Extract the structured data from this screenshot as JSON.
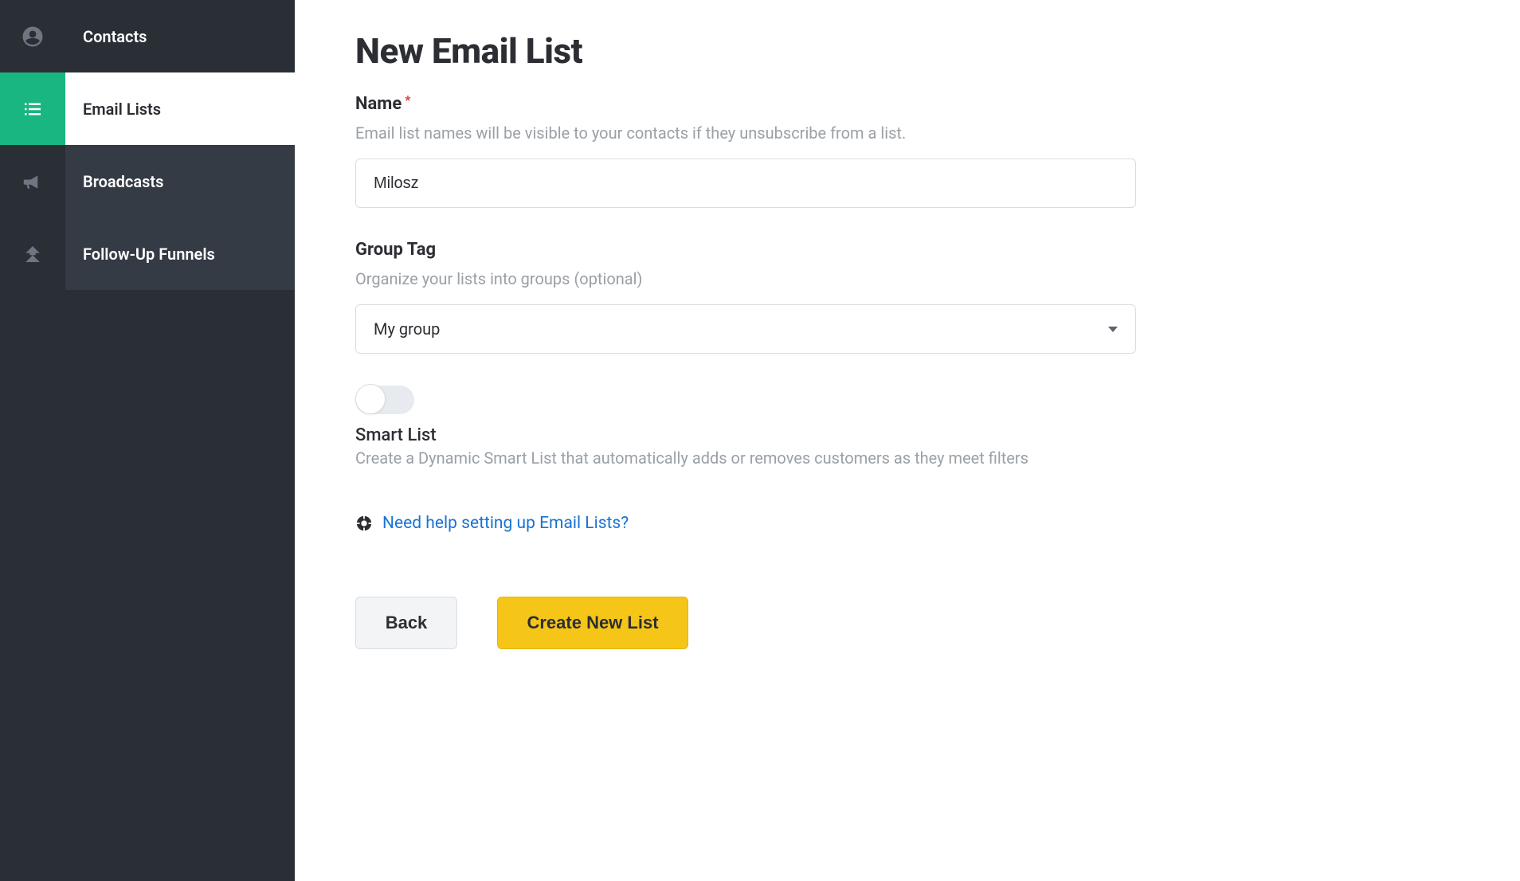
{
  "sidebar": {
    "items": [
      {
        "label": "Contacts",
        "icon": "user-circle-icon",
        "active": false
      },
      {
        "label": "Email Lists",
        "icon": "list-icon",
        "active": true
      },
      {
        "label": "Broadcasts",
        "icon": "megaphone-icon",
        "active": false
      },
      {
        "label": "Follow-Up Funnels",
        "icon": "double-chevron-up-icon",
        "active": false
      }
    ]
  },
  "page": {
    "title": "New Email List",
    "name_field": {
      "label": "Name",
      "required_mark": "*",
      "help": "Email list names will be visible to your contacts if they unsubscribe from a list.",
      "value": "Milosz"
    },
    "group_tag_field": {
      "label": "Group Tag",
      "help": "Organize your lists into groups (optional)",
      "selected": "My group"
    },
    "smart_list": {
      "toggle_on": false,
      "title": "Smart List",
      "description": "Create a Dynamic Smart List that automatically adds or removes customers as they meet filters"
    },
    "help_link": "Need help setting up Email Lists?",
    "buttons": {
      "back": "Back",
      "create": "Create New List"
    }
  }
}
